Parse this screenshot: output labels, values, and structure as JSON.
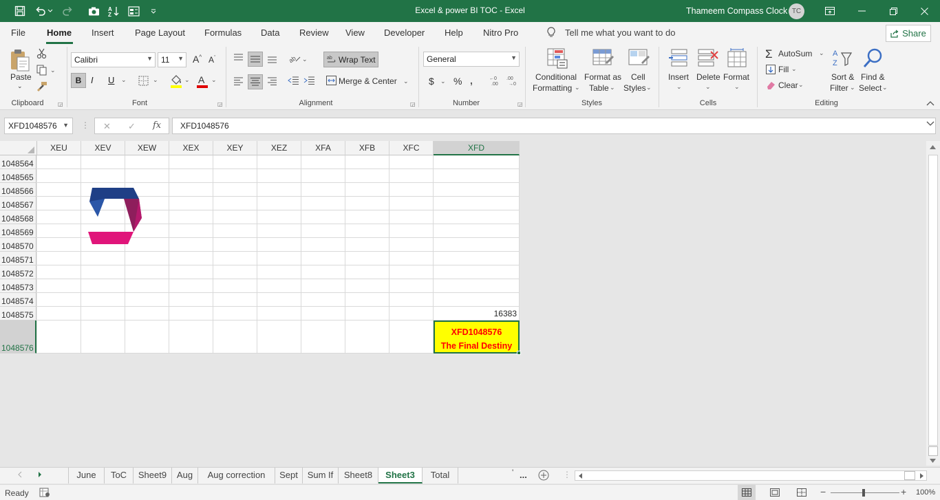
{
  "title_bar": {
    "title": "Excel & power BI TOC  -  Excel",
    "user_name": "Thameem Compass Clock",
    "avatar_initials": "TC"
  },
  "menu": {
    "tabs": [
      "File",
      "Home",
      "Insert",
      "Page Layout",
      "Formulas",
      "Data",
      "Review",
      "View",
      "Developer",
      "Help",
      "Nitro Pro"
    ],
    "active_tab": "Home",
    "tell_me": "Tell me what you want to do",
    "share": "Share"
  },
  "ribbon": {
    "clipboard": {
      "label": "Clipboard",
      "paste": "Paste"
    },
    "font": {
      "label": "Font",
      "font_name": "Calibri",
      "font_size": "11",
      "bold": "B",
      "italic": "I",
      "underline": "U"
    },
    "alignment": {
      "label": "Alignment",
      "wrap_text": "Wrap Text",
      "merge_center": "Merge & Center"
    },
    "number": {
      "label": "Number",
      "format": "General",
      "currency": "$",
      "percent": "%"
    },
    "styles": {
      "label": "Styles",
      "conditional_formatting": [
        "Conditional",
        "Formatting"
      ],
      "format_as_table": [
        "Format as",
        "Table"
      ],
      "cell_styles": [
        "Cell",
        "Styles"
      ]
    },
    "cells": {
      "label": "Cells",
      "insert": "Insert",
      "delete": "Delete",
      "format": "Format"
    },
    "editing": {
      "label": "Editing",
      "autosum": "AutoSum",
      "fill": "Fill",
      "clear": "Clear",
      "sort_filter": [
        "Sort &",
        "Filter"
      ],
      "find_select": [
        "Find &",
        "Select"
      ]
    }
  },
  "formula_bar": {
    "name_box": "XFD1048576",
    "fx": "fx",
    "formula": "XFD1048576"
  },
  "grid": {
    "columns": [
      "XEU",
      "XEV",
      "XEW",
      "XEX",
      "XEY",
      "XEZ",
      "XFA",
      "XFB",
      "XFC",
      "XFD"
    ],
    "selected_column": "XFD",
    "rows": [
      "1048564",
      "1048565",
      "1048566",
      "1048567",
      "1048568",
      "1048569",
      "1048570",
      "1048571",
      "1048572",
      "1048573",
      "1048574",
      "1048575",
      "1048576"
    ],
    "selected_row": "1048576",
    "value_row_1048575": "16383",
    "final_cell": {
      "line1": "XFD1048576",
      "line2": "The Final Destiny",
      "fill": "#ffff00",
      "text_color": "#ff0000"
    }
  },
  "sheets": {
    "tabs": [
      "June",
      "ToC",
      "Sheet9",
      "Aug",
      "Aug correction",
      "Sept",
      "Sum If",
      "Sheet8",
      "Sheet3",
      "Total"
    ],
    "active": "Sheet3",
    "more": "..."
  },
  "status": {
    "ready": "Ready",
    "zoom": "100%"
  },
  "colors": {
    "accent": "#217346",
    "logo_blue": "#1f3f86",
    "logo_magenta": "#e0157a"
  }
}
